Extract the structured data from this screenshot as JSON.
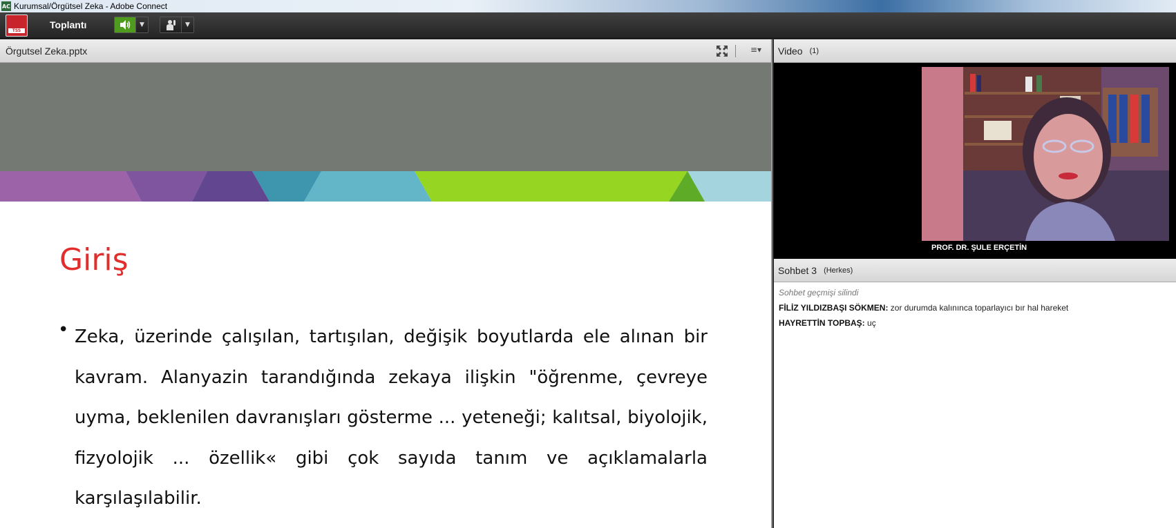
{
  "window": {
    "title": "Kurumsal/Örgütsel Zeka - Adobe Connect"
  },
  "toolbar": {
    "logo_text": "TSS",
    "meeting_menu": "Toplantı",
    "speaker_active_color": "#4f9b1e"
  },
  "share_pod": {
    "title": "Örgutsel Zeka.pptx",
    "icons": [
      "fullscreen-icon",
      "pod-menu-icon"
    ]
  },
  "slide": {
    "heading": "Giriş",
    "body": "Zeka, üzerinde çalışılan, tartışılan, değişik boyutlarda ele alınan bir kavram. Alanyazin tarandığında zekaya ilişkin \"öğrenme, çevreye uyma, beklenilen davranışları gösterme ... yeteneği; kalıtsal, biyolojik, fizyolojik ... özellik« gibi çok sayıda tanım ve açıklamalarla karşılaşılabilir.",
    "heading_color": "#e32d2d"
  },
  "video_pod": {
    "title": "Video",
    "count": "(1)",
    "presenter": "PROF. DR. ŞULE  ERÇETİN"
  },
  "chat_pod": {
    "title": "Sohbet 3",
    "scope": "(Herkes)",
    "note": "Sohbet geçmişi silindi",
    "messages": [
      {
        "sender": "FİLİZ YILDIZBAŞI SÖKMEN:",
        "text": "zor durumda kalınınca toparlayıcı bır hal hareket"
      },
      {
        "sender": "HAYRETTİN TOPBAŞ:",
        "text": "uç"
      }
    ]
  }
}
